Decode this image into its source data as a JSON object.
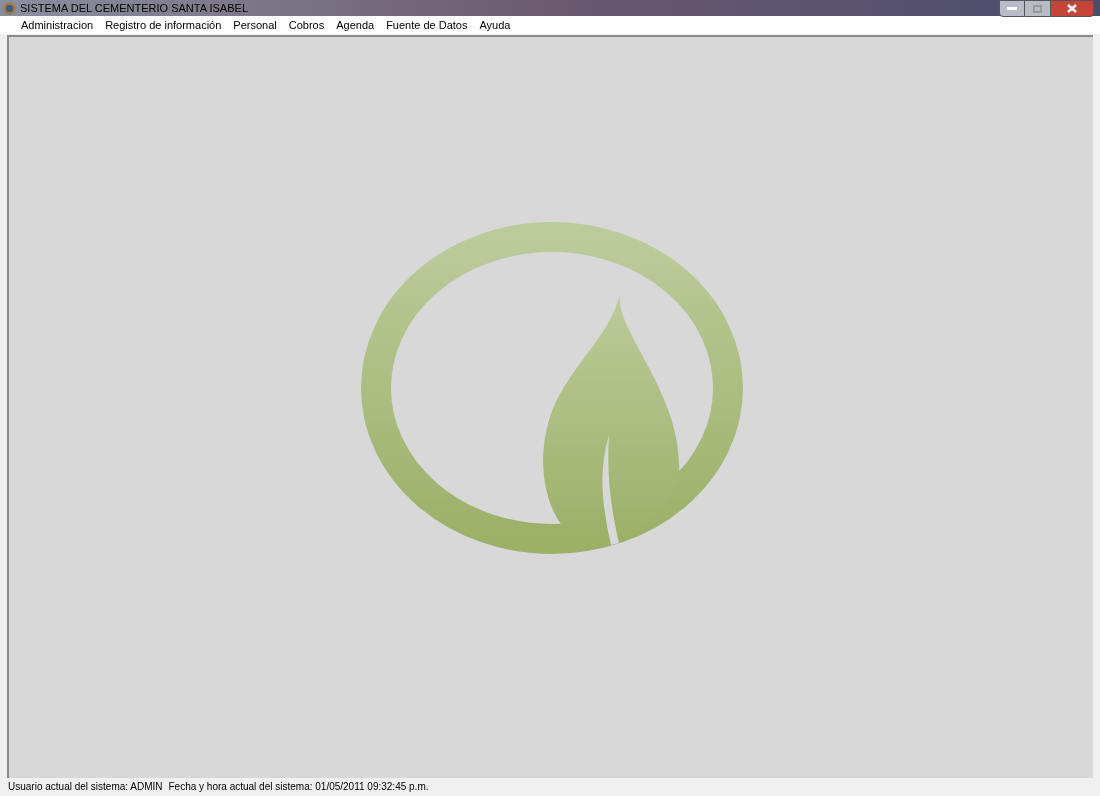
{
  "window": {
    "title": "SISTEMA DEL CEMENTERIO SANTA ISABEL"
  },
  "menu": [
    "Administracion",
    "Registro de información",
    "Personal",
    "Cobros",
    "Agenda",
    "Fuente de Datos",
    "Ayuda"
  ],
  "status_bar": [
    "Usuario actual del sistema: ADMIN",
    "Fecha y hora actual del sistema: 01/05/2011 09:32:45 p.m."
  ]
}
